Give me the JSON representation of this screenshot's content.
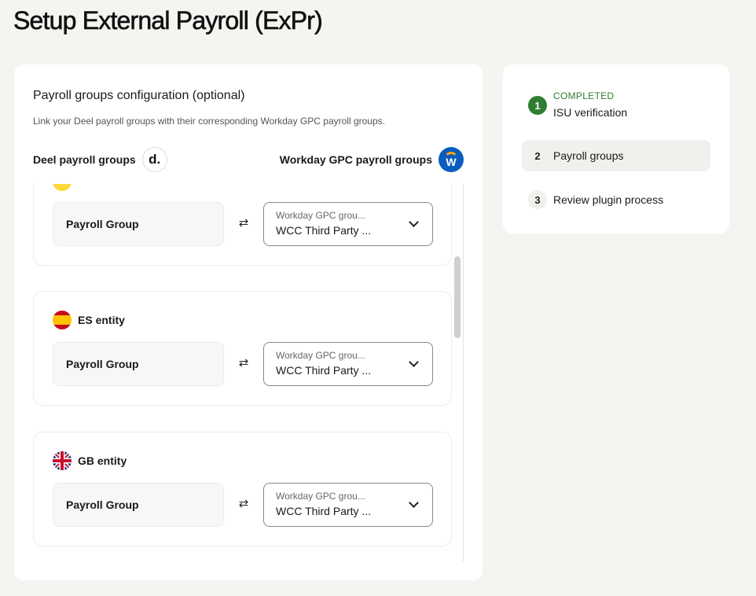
{
  "page": {
    "title": "Setup External Payroll (ExPr)"
  },
  "main": {
    "section_title": "Payroll groups configuration (optional)",
    "section_desc": "Link your Deel payroll groups with their corresponding Workday GPC payroll groups.",
    "left_header": "Deel payroll groups",
    "right_header": "Workday GPC payroll groups",
    "deel_logo": "d.",
    "workday_logo": "W",
    "entities": [
      {
        "name": "",
        "flag": "yellow",
        "payroll_group": "Payroll Group",
        "select_label": "Workday GPC grou...",
        "select_value": "WCC Third Party ..."
      },
      {
        "name": "ES entity",
        "flag": "es",
        "payroll_group": "Payroll Group",
        "select_label": "Workday GPC grou...",
        "select_value": "WCC Third Party ..."
      },
      {
        "name": "GB entity",
        "flag": "gb",
        "payroll_group": "Payroll Group",
        "select_label": "Workday GPC grou...",
        "select_value": "WCC Third Party ..."
      }
    ]
  },
  "steps": {
    "completed_label": "COMPLETED",
    "items": [
      {
        "num": "1",
        "label": "ISU verification",
        "state": "completed"
      },
      {
        "num": "2",
        "label": "Payroll groups",
        "state": "active"
      },
      {
        "num": "3",
        "label": "Review plugin process",
        "state": "pending"
      }
    ]
  },
  "icons": {
    "swap": "swap-arrows-icon",
    "chevron": "chevron-down-icon"
  },
  "colors": {
    "background": "#f5f4f1",
    "completed_green": "#2e7d32",
    "workday_blue": "#0a5dbe",
    "workday_orange": "#f6a418"
  }
}
